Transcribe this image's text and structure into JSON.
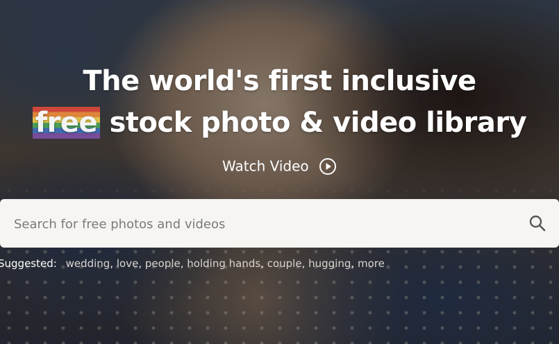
{
  "hero": {
    "headline_line1": "The world's first inclusive",
    "headline_highlight": "free",
    "headline_line2_rest": " stock photo & video library",
    "watch_label": "Watch Video"
  },
  "search": {
    "placeholder": "Search for free photos and videos",
    "value": ""
  },
  "suggested": {
    "label": "Suggested:",
    "items": [
      "wedding",
      "love",
      "people",
      "holding hands",
      "couple",
      "hugging",
      "more"
    ]
  },
  "colors": {
    "search_background": "#f6f5f2",
    "headline_text": "#ffffff",
    "rainbow": [
      "#d64a3a",
      "#e88a3c",
      "#e8c94a",
      "#4da35a",
      "#3f6fb5",
      "#7b4e9e"
    ]
  },
  "icons": {
    "play": "play-circle-icon",
    "search": "search-icon"
  }
}
